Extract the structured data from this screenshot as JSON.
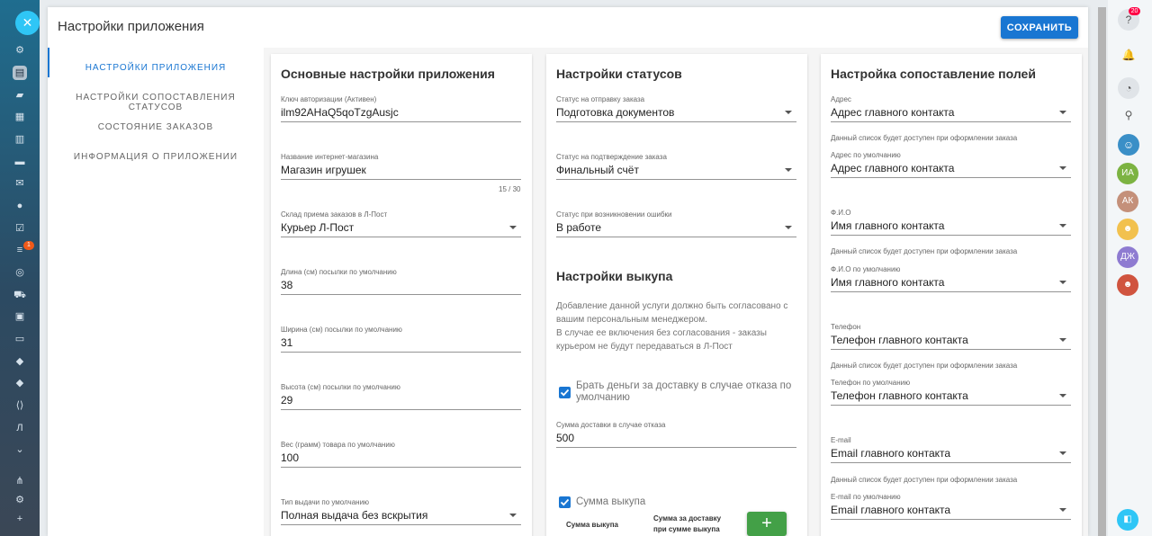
{
  "header": {
    "title": "Настройки приложения",
    "save_label": "СОХРАНИТЬ"
  },
  "nav": [
    {
      "label": "НАСТРОЙКИ ПРИЛОЖЕНИЯ",
      "active": true
    },
    {
      "label": "НАСТРОЙКИ СОПОСТАВЛЕНИЯ СТАТУСОВ",
      "active": false
    },
    {
      "label": "СОСТОЯНИЕ ЗАКАЗОВ",
      "active": false
    },
    {
      "label": "ИНФОРМАЦИЯ О ПРИЛОЖЕНИИ",
      "active": false
    }
  ],
  "basic": {
    "title": "Основные настройки приложения",
    "fields": [
      {
        "label": "Ключ авторизации (Активен)",
        "value": "ilm92AHaQ5qoTzgAusjc"
      },
      {
        "label": "Название интернет-магазина",
        "value": "Магазин игрушек",
        "counter": "15 / 30"
      },
      {
        "label": "Склад приема заказов в Л-Пост",
        "value": "Курьер Л-Пост"
      },
      {
        "label": "Длина (см) посылки по умолчанию",
        "value": "38"
      },
      {
        "label": "Ширина (см) посылки по умолчанию",
        "value": "31"
      },
      {
        "label": "Высота (см) посылки по умолчанию",
        "value": "29"
      },
      {
        "label": "Вес (грамм) товара по умолчанию",
        "value": "100"
      },
      {
        "label": "Тип выдачи по умолчанию",
        "value": "Полная выдача без вскрытия"
      }
    ]
  },
  "statuses": {
    "title": "Настройки статусов",
    "fields": [
      {
        "label": "Статус на отправку заказа",
        "value": "Подготовка документов"
      },
      {
        "label": "Статус на подтверждение заказа",
        "value": "Финальный счёт"
      },
      {
        "label": "Статус при возникновении ошибки",
        "value": "В работе"
      }
    ]
  },
  "buyout": {
    "title": "Настройки выкупа",
    "info_lines": [
      "Добавление данной услуги должно быть согласовано с",
      "вашим персональным менеджером.",
      "В случае ее включения без согласования - заказы",
      "курьером не будут передаваться в Л-Пост"
    ],
    "checkbox1_line1": "Брать деньги за доставку в случае отказа по",
    "checkbox1_line2": "умолчанию",
    "refusal_label": "Сумма доставки в случае отказа",
    "refusal_value": "500",
    "checkbox2": "Сумма выкупа",
    "col1": "Сумма выкупа",
    "col2_line1": "Сумма за доставку",
    "col2_line2": "при сумме выкупа",
    "add_symbol": "+"
  },
  "mapping": {
    "title": "Настройка сопоставление полей",
    "hint": "Данный список будет доступен при оформлении заказа",
    "fields": [
      {
        "label": "Адрес",
        "value": "Адрес главного контакта"
      },
      {
        "label": "Адрес по умолчанию",
        "value": "Адрес главного контакта"
      },
      {
        "label": "Ф.И.О",
        "value": "Имя главного контакта"
      },
      {
        "label": "Ф.И.О по умолчанию",
        "value": "Имя главного контакта"
      },
      {
        "label": "Телефон",
        "value": "Телефон главного контакта"
      },
      {
        "label": "Телефон по умолчанию",
        "value": "Телефон главного контакта"
      },
      {
        "label": "E-mail",
        "value": "Email главного контакта"
      },
      {
        "label": "E-mail по умолчанию",
        "value": "Email главного контакта"
      }
    ]
  },
  "left_sidebar": {
    "close_symbol": "✕",
    "badge": "1",
    "l_letter": "Л"
  },
  "right_sidebar": {
    "help_badge": "20",
    "avatars": [
      {
        "initials": "ИА",
        "color": "#7cb342"
      },
      {
        "initials": "АК",
        "color": "#c4907a"
      },
      {
        "initials": "ДЖ",
        "color": "#8e7bd1"
      }
    ]
  },
  "colors": {
    "accent": "#1976d2",
    "add_button": "#43a047"
  }
}
